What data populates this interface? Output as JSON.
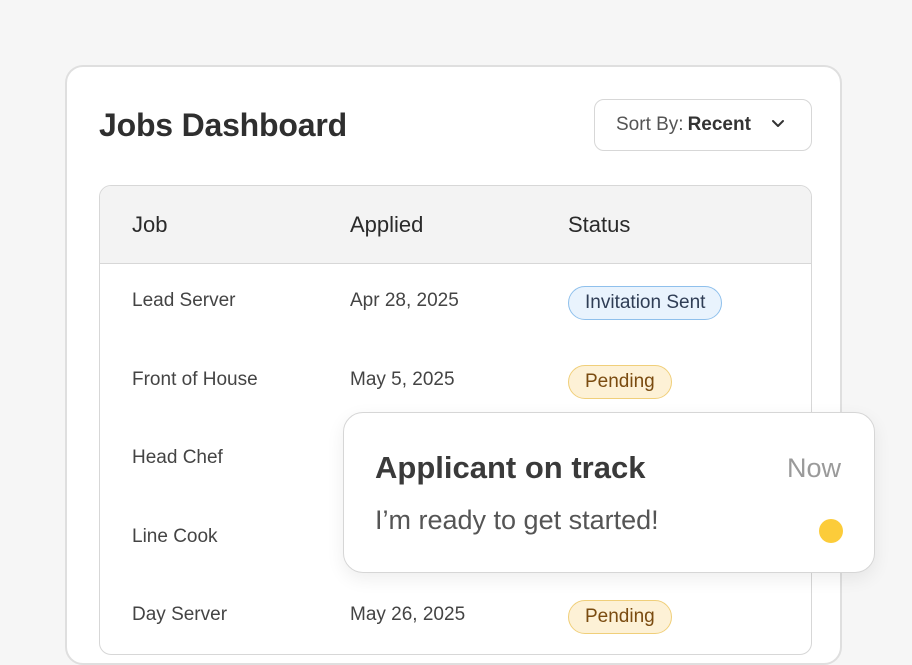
{
  "dashboard": {
    "title": "Jobs Dashboard",
    "sort": {
      "prefix": "Sort By:",
      "value": "Recent"
    }
  },
  "table": {
    "columns": [
      "Job",
      "Applied",
      "Status"
    ],
    "rows": [
      {
        "job": "Lead Server",
        "applied": "Apr 28, 2025",
        "status": "Invitation Sent",
        "status_color": "blue"
      },
      {
        "job": "Front of House",
        "applied": "May 5, 2025",
        "status": "Pending",
        "status_color": "yellow"
      },
      {
        "job": "Head Chef",
        "applied": "",
        "status": "",
        "status_color": ""
      },
      {
        "job": "Line Cook",
        "applied": "",
        "status": "",
        "status_color": ""
      },
      {
        "job": "Day Server",
        "applied": "May 26, 2025",
        "status": "Pending",
        "status_color": "yellow"
      }
    ]
  },
  "notification": {
    "title": "Applicant on track",
    "time": "Now",
    "message": "I’m ready to get started!",
    "dot_color": "#fccc3a"
  },
  "colors": {
    "background": "#f6f6f6",
    "badge_blue_bg": "#e9f3fd",
    "badge_blue_border": "#8fc0ec",
    "badge_yellow_bg": "#fdf1d6",
    "badge_yellow_border": "#f0cf7a"
  },
  "icons": {
    "sort_chevron": "chevron-down-icon",
    "notification_dot": "status-dot-icon"
  }
}
